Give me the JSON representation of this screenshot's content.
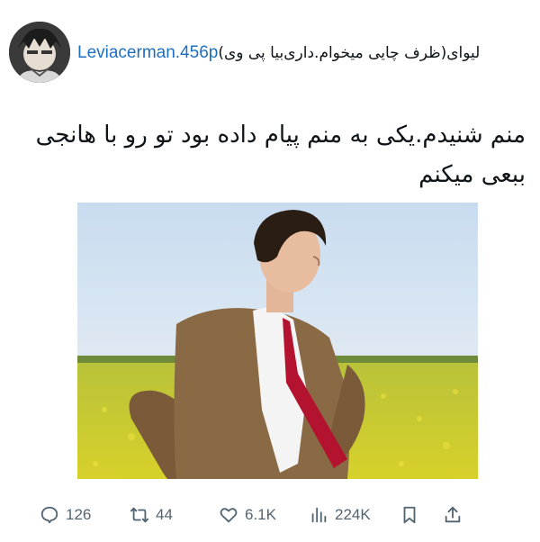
{
  "author": {
    "display_name": "لیوای(ظرف چایی میخوام.داری‌بیا پی وی)",
    "handle": "Leviacerman.456p"
  },
  "tweet": {
    "text": "منم شنیدم.یکی به منم پیام داده بود تو رو با هانجی ببعی میکنم"
  },
  "stats": {
    "replies": "126",
    "retweets": "44",
    "likes": "6.1K",
    "views": "224K"
  },
  "icons": {
    "reply": "speech-bubble-icon",
    "retweet": "retweet-arrows-icon",
    "like": "heart-icon",
    "views": "bar-chart-icon",
    "bookmark": "bookmark-icon",
    "share": "share-upload-icon"
  },
  "colors": {
    "handle": "#1d6fc2",
    "action_gray": "#536471",
    "text": "#0f1419"
  }
}
